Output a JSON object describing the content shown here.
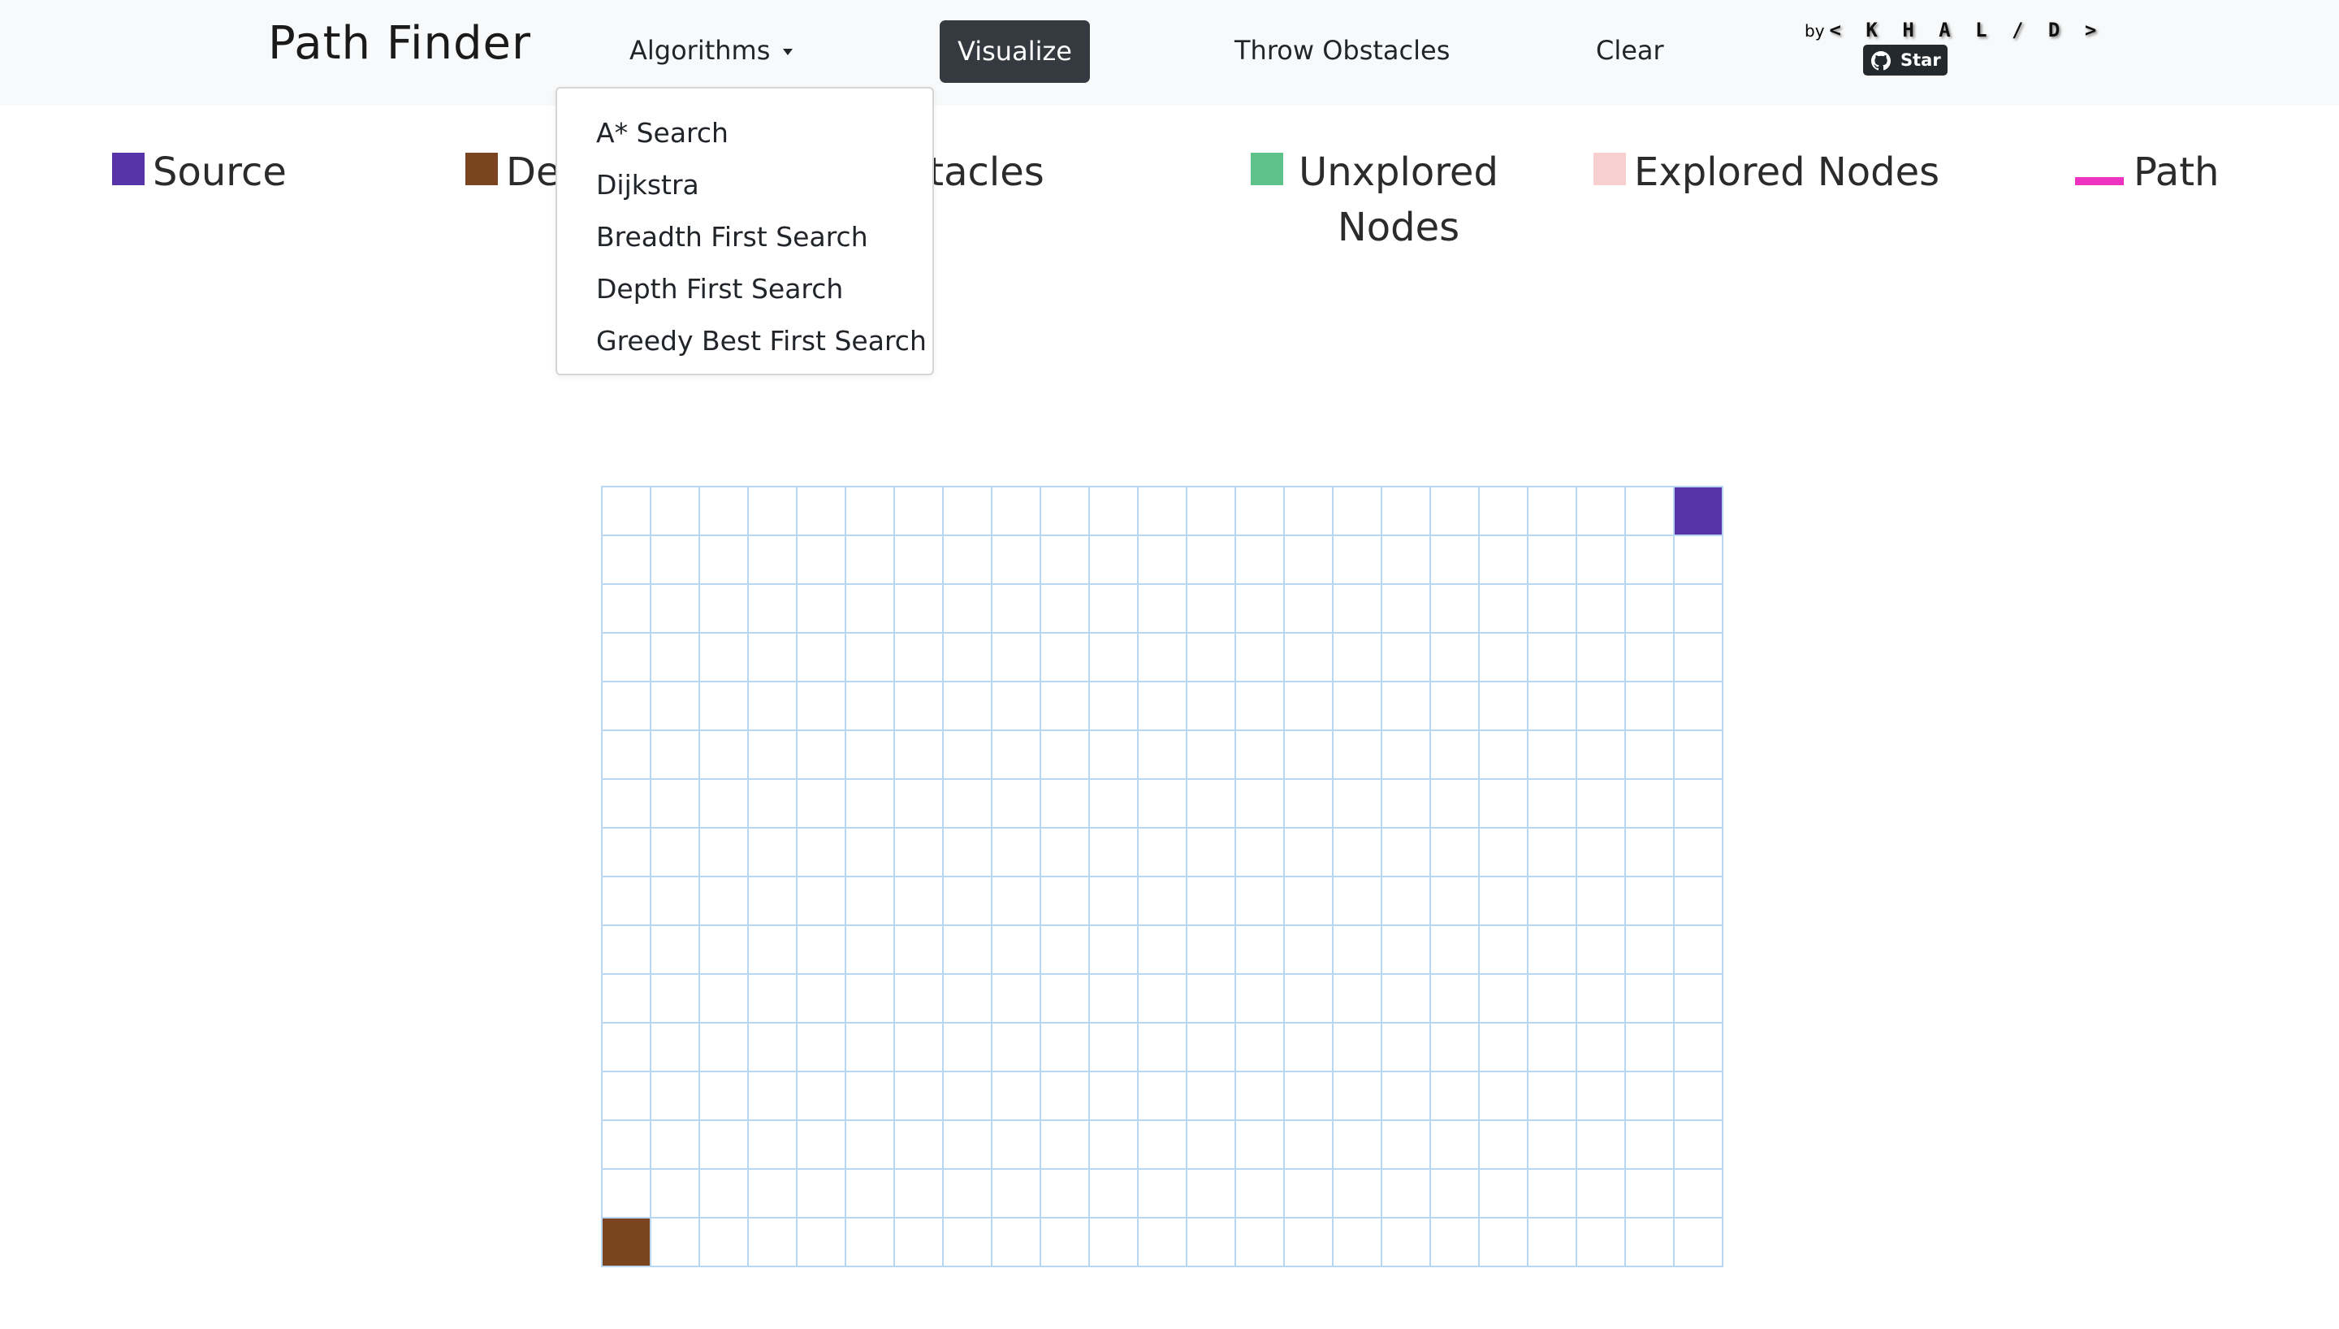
{
  "navbar": {
    "brand": "Path Finder",
    "algorithms_label": "Algorithms",
    "visualize_label": "Visualize",
    "throw_obstacles_label": "Throw Obstacles",
    "clear_label": "Clear",
    "by_text": "by",
    "author": "< K H A L / D >",
    "star_label": "Star"
  },
  "algorithms_menu": {
    "items": [
      "A* Search",
      "Dijkstra",
      "Breadth First Search",
      "Depth First Search",
      "Greedy Best First Search"
    ]
  },
  "legend": {
    "items": [
      {
        "label": "Source",
        "color": "#5634a8"
      },
      {
        "label": "Destination",
        "color": "#7b4420"
      },
      {
        "label": "Obstacles",
        "color": "#343a40"
      },
      {
        "label": "Unxplored Nodes",
        "color": "#5ec28a"
      },
      {
        "label": "Explored Nodes",
        "color": "#f7cfcf"
      },
      {
        "label": "Path",
        "color": "#ee33c0"
      }
    ]
  },
  "grid": {
    "rows": 16,
    "cols": 23,
    "source": {
      "row": 0,
      "col": 22
    },
    "destination": {
      "row": 15,
      "col": 0
    },
    "cell_color": "#ffffff",
    "border_color": "#b9d6f2"
  }
}
